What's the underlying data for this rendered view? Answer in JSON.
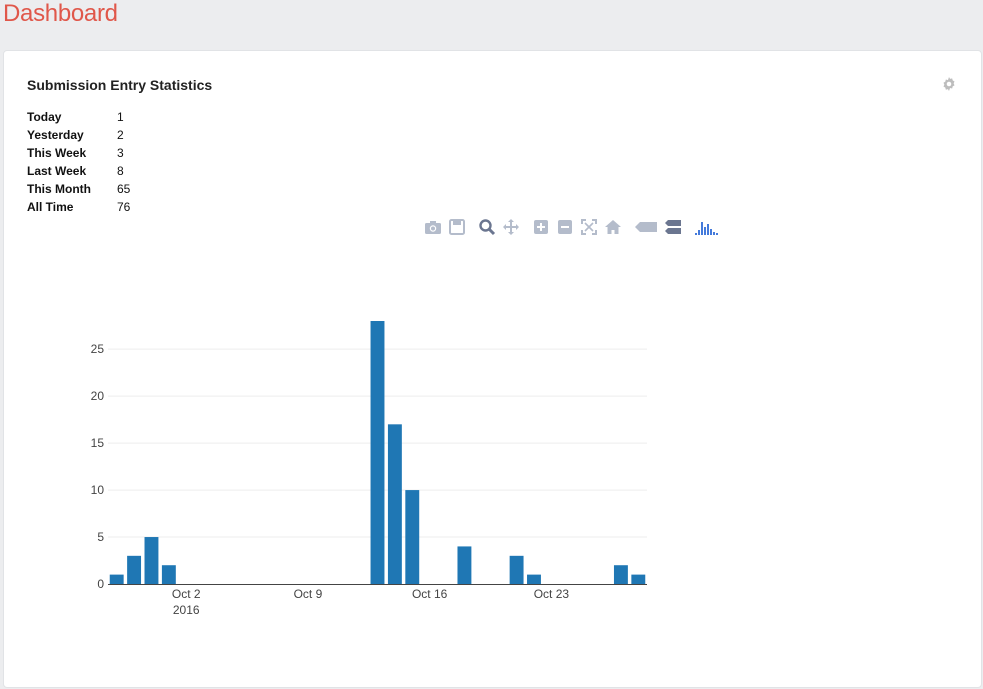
{
  "page": {
    "title": "Dashboard"
  },
  "card": {
    "title": "Submission Entry Statistics"
  },
  "stats": [
    {
      "label": "Today",
      "value": "1"
    },
    {
      "label": "Yesterday",
      "value": "2"
    },
    {
      "label": "This Week",
      "value": "3"
    },
    {
      "label": "Last Week",
      "value": "8"
    },
    {
      "label": "This Month",
      "value": "65"
    },
    {
      "label": "All Time",
      "value": "76"
    }
  ],
  "modebar": {
    "buttons": [
      "camera-icon",
      "save-icon",
      "zoom-icon",
      "pan-icon",
      "zoom-in-icon",
      "zoom-out-icon",
      "autoscale-icon",
      "reset-axes-icon",
      "hover-closest-icon",
      "hover-compare-icon",
      "plotly-logo-icon"
    ]
  },
  "colors": {
    "accent": "#e0574a",
    "bar": "#1f77b4",
    "grid": "#eeeeee",
    "modebar": "#b4bccb",
    "logo": "#447adb"
  },
  "chart_data": {
    "type": "bar",
    "x": [
      "2016-09-28",
      "2016-09-29",
      "2016-09-30",
      "2016-10-01",
      "2016-10-02",
      "2016-10-03",
      "2016-10-04",
      "2016-10-05",
      "2016-10-06",
      "2016-10-07",
      "2016-10-08",
      "2016-10-09",
      "2016-10-10",
      "2016-10-11",
      "2016-10-12",
      "2016-10-13",
      "2016-10-14",
      "2016-10-15",
      "2016-10-16",
      "2016-10-17",
      "2016-10-18",
      "2016-10-19",
      "2016-10-20",
      "2016-10-21",
      "2016-10-22",
      "2016-10-23",
      "2016-10-24",
      "2016-10-25",
      "2016-10-26",
      "2016-10-27",
      "2016-10-28"
    ],
    "values": [
      1,
      3,
      5,
      2,
      0,
      0,
      0,
      0,
      0,
      0,
      0,
      0,
      0,
      0,
      0,
      28,
      17,
      10,
      0,
      0,
      4,
      0,
      0,
      3,
      1,
      0,
      0,
      0,
      0,
      2,
      1
    ],
    "ylim": [
      0,
      28
    ],
    "yticks": [
      "0",
      "5",
      "10",
      "15",
      "20",
      "25"
    ],
    "xticks": [
      {
        "label": "Oct 2",
        "sublabel": "2016",
        "index": 4.5
      },
      {
        "label": "Oct 9",
        "sublabel": "",
        "index": 11.5
      },
      {
        "label": "Oct 16",
        "sublabel": "",
        "index": 18.5
      },
      {
        "label": "Oct 23",
        "sublabel": "",
        "index": 25.5
      }
    ],
    "grid": true
  }
}
